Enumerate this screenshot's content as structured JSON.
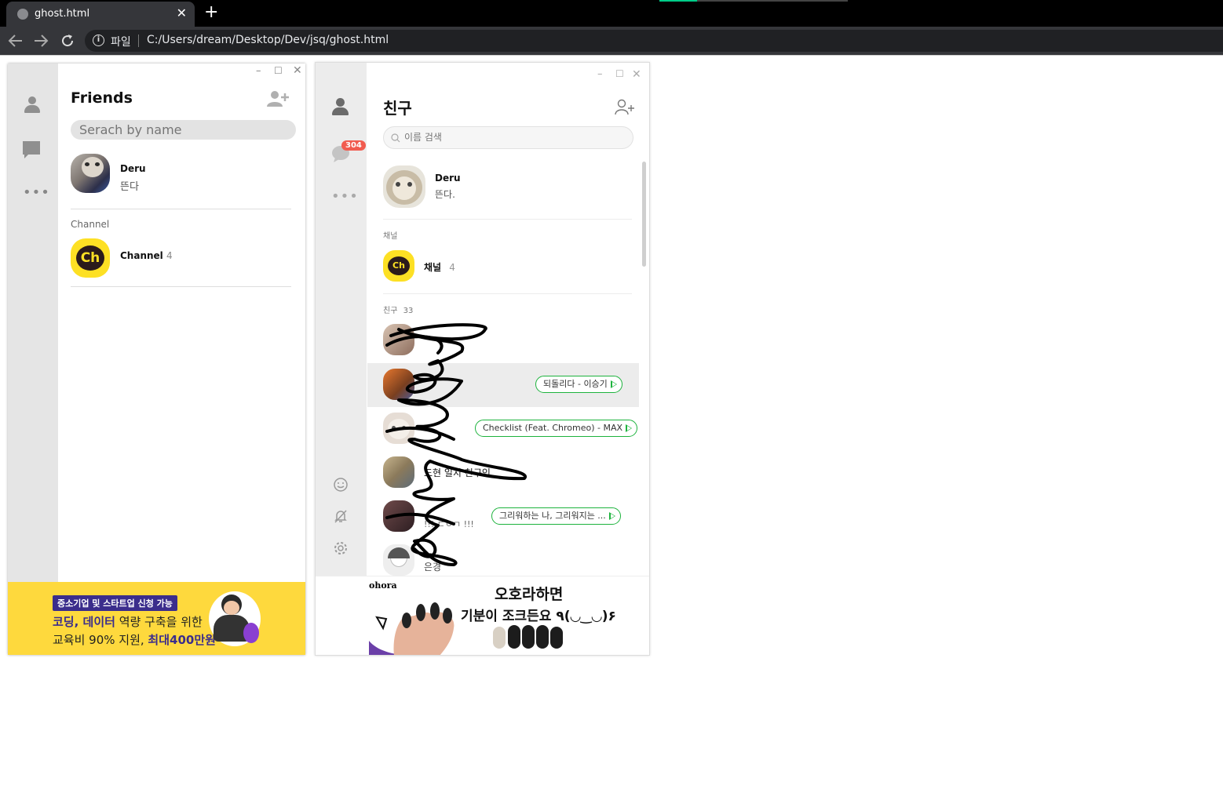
{
  "browser": {
    "tab_title": "ghost.html",
    "tab_close": "✕",
    "new_tab": "+",
    "scheme_label": "파일",
    "url": "C:/Users/dream/Desktop/Dev/jsq/ghost.html"
  },
  "window1": {
    "title": "Friends",
    "search_placeholder": "Serach by name",
    "profile": {
      "name": "Deru",
      "status": "뜬다"
    },
    "channel_section": "Channel",
    "channel": {
      "name": "Channel",
      "count": "4",
      "logo": "Ch"
    },
    "ad": {
      "badge": "중소기업 및 스타트업 신청 가능",
      "line1_a": "코딩, 데이터",
      "line1_b": " 역량 구축을 위한",
      "line2_a": "교육비 90% 지원, ",
      "line2_b": "최대400만원"
    }
  },
  "window2": {
    "title": "친구",
    "search_placeholder": "이름 검색",
    "chat_badge": "304",
    "profile": {
      "name": "Deru",
      "status": "뜬다."
    },
    "channel_section": "채널",
    "channel": {
      "name": "채널",
      "count": "4",
      "logo": "Ch"
    },
    "friends_section": "친구",
    "friends_count": "33",
    "friends": [
      {
        "name": "",
        "status": "",
        "music": ""
      },
      {
        "name": "",
        "status": "",
        "music": "되돌리다 - 이승기"
      },
      {
        "name": "",
        "status": "",
        "music": "Checklist (Feat. Chromeo) - MAX"
      },
      {
        "name": "도현 일치 친구인",
        "status": "",
        "music": ""
      },
      {
        "name": "",
        "status": "!!! ㄷㅇㄱ !!!",
        "music": "그리워하는 나, 그리워지는 ..."
      },
      {
        "name": "은경",
        "status": "",
        "music": ""
      }
    ],
    "ad": {
      "brand": "ohora",
      "line1": "오호라하면",
      "line2": "기분이 조크든요 ٩(◡‿◡)۶"
    }
  },
  "colors": {
    "accent_yellow": "#fde024",
    "music_green": "#1db33d",
    "badge_red": "#f15b4f"
  }
}
